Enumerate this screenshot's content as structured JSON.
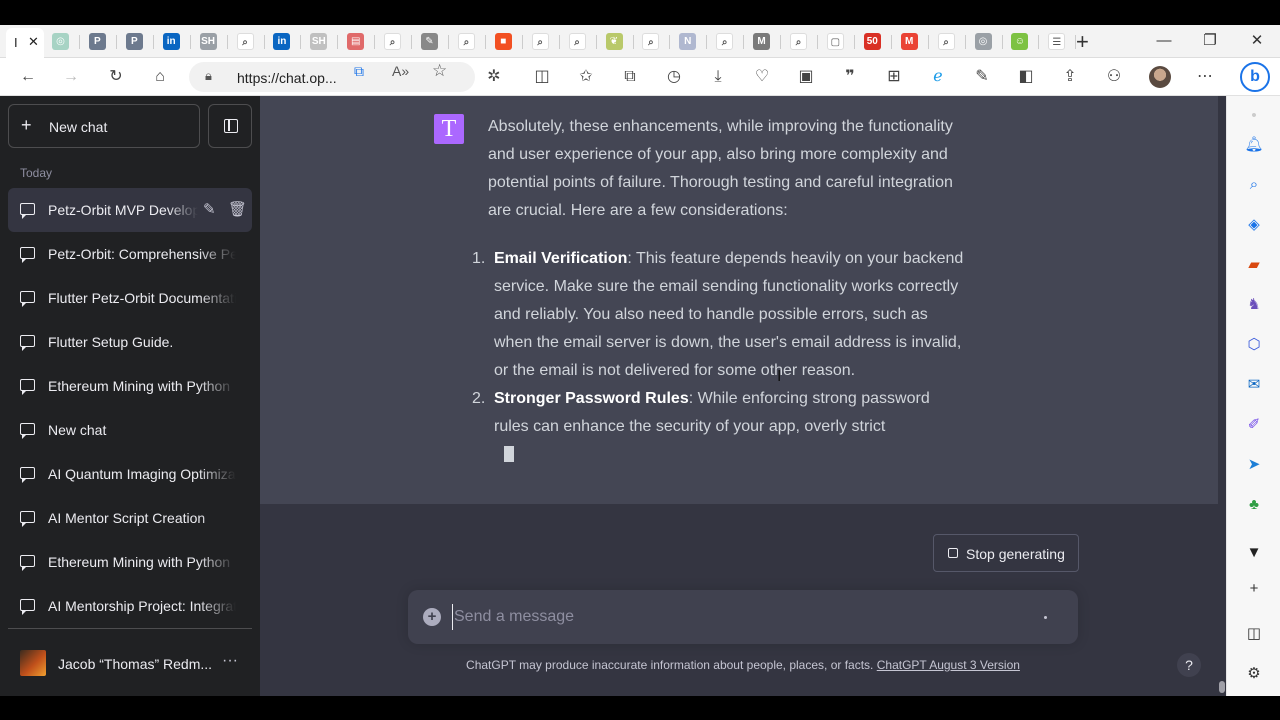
{
  "browser": {
    "active_tab_title": "I",
    "tab_close": "✕",
    "new_tab": "+",
    "window_controls": {
      "minimize": "—",
      "restore": "❐",
      "close": "✕"
    },
    "address_url": "https://chat.op...",
    "tab_icons": [
      {
        "name": "tab-chatgpt-icon",
        "color": "#a7d3c4",
        "glyph": "◎"
      },
      {
        "name": "tab-p-icon",
        "color": "#6d7a8e",
        "glyph": "P"
      },
      {
        "name": "tab-p2-icon",
        "color": "#6d7a8e",
        "glyph": "P"
      },
      {
        "name": "tab-linkedin-icon",
        "color": "#0a66c2",
        "glyph": "in"
      },
      {
        "name": "tab-sh-icon",
        "color": "#9aa0a6",
        "glyph": "SH"
      },
      {
        "name": "tab-search-icon",
        "color": "#ffffff",
        "glyph": "⌕"
      },
      {
        "name": "tab-linkedin2-icon",
        "color": "#0a66c2",
        "glyph": "in"
      },
      {
        "name": "tab-sh2-icon",
        "color": "#c0c0c0",
        "glyph": "SH"
      },
      {
        "name": "tab-pdf-icon",
        "color": "#e06a6a",
        "glyph": "▤"
      },
      {
        "name": "tab-search2-icon",
        "color": "#ffffff",
        "glyph": "⌕"
      },
      {
        "name": "tab-tools-icon",
        "color": "#888888",
        "glyph": "✎"
      },
      {
        "name": "tab-search3-icon",
        "color": "#ffffff",
        "glyph": "⌕"
      },
      {
        "name": "tab-microsoft-icon",
        "color": "#f25022",
        "glyph": "■"
      },
      {
        "name": "tab-search4-icon",
        "color": "#ffffff",
        "glyph": "⌕"
      },
      {
        "name": "tab-search5-icon",
        "color": "#ffffff",
        "glyph": "⌕"
      },
      {
        "name": "tab-leaf-icon",
        "color": "#b9c96a",
        "glyph": "❦"
      },
      {
        "name": "tab-search6-icon",
        "color": "#ffffff",
        "glyph": "⌕"
      },
      {
        "name": "tab-n-icon",
        "color": "#b0b8d0",
        "glyph": "N"
      },
      {
        "name": "tab-search7-icon",
        "color": "#ffffff",
        "glyph": "⌕"
      },
      {
        "name": "tab-m-icon",
        "color": "#7a7a7a",
        "glyph": "M"
      },
      {
        "name": "tab-search8-icon",
        "color": "#ffffff",
        "glyph": "⌕"
      },
      {
        "name": "tab-calendar-icon",
        "color": "#ffffff",
        "glyph": "▢"
      },
      {
        "name": "tab-50plus-icon",
        "color": "#d93025",
        "glyph": "50"
      },
      {
        "name": "tab-gmail-icon",
        "color": "#ea4335",
        "glyph": "M"
      },
      {
        "name": "tab-search9-icon",
        "color": "#ffffff",
        "glyph": "⌕"
      },
      {
        "name": "tab-openai-icon",
        "color": "#9aa0a6",
        "glyph": "◎"
      },
      {
        "name": "tab-smiley-icon",
        "color": "#7dc242",
        "glyph": "☺"
      },
      {
        "name": "tab-settings-icon",
        "color": "#ffffff",
        "glyph": "☰"
      }
    ]
  },
  "sidebar": {
    "new_chat_label": "New chat",
    "section_label": "Today",
    "chats": [
      {
        "title": "Petz-Orbit MVP Development"
      },
      {
        "title": "Petz-Orbit: Comprehensive Pet Care"
      },
      {
        "title": "Flutter Petz-Orbit Documentation"
      },
      {
        "title": "Flutter Setup Guide."
      },
      {
        "title": "Ethereum Mining with Python"
      },
      {
        "title": "New chat"
      },
      {
        "title": "AI Quantum Imaging Optimization"
      },
      {
        "title": "AI Mentor Script Creation"
      },
      {
        "title": "Ethereum Mining with Python"
      },
      {
        "title": "AI Mentorship Project: Integration"
      }
    ],
    "user_name": "Jacob “Thomas” Redm...",
    "more_glyph": "···"
  },
  "conversation": {
    "avatar_letter": "T",
    "avatar_color": "#ab68ff",
    "intro": "Absolutely, these enhancements, while improving the functionality and user experience of your app, also bring more complexity and potential points of failure. Thorough testing and careful integration are crucial. Here are a few considerations:",
    "items": [
      {
        "num": "1.",
        "heading": "Email Verification",
        "text": ": This feature depends heavily on your backend service. Make sure the email sending functionality works correctly and reliably. You also need to handle possible errors, such as when the email server is down, the user's email address is invalid, or the email is not delivered for some other reason."
      },
      {
        "num": "2.",
        "heading": "Stronger Password Rules",
        "text": ": While enforcing strong password rules can enhance the security of your app, overly strict"
      }
    ]
  },
  "composer": {
    "stop_label": "Stop generating",
    "placeholder": "Send a message",
    "disclaimer": "ChatGPT may produce inaccurate information about people, places, or facts.",
    "version_link": "ChatGPT August 3 Version",
    "help_glyph": "?"
  },
  "colors": {
    "sidebar_bg": "#202123",
    "main_bg": "#343541",
    "message_bg": "#444654"
  }
}
